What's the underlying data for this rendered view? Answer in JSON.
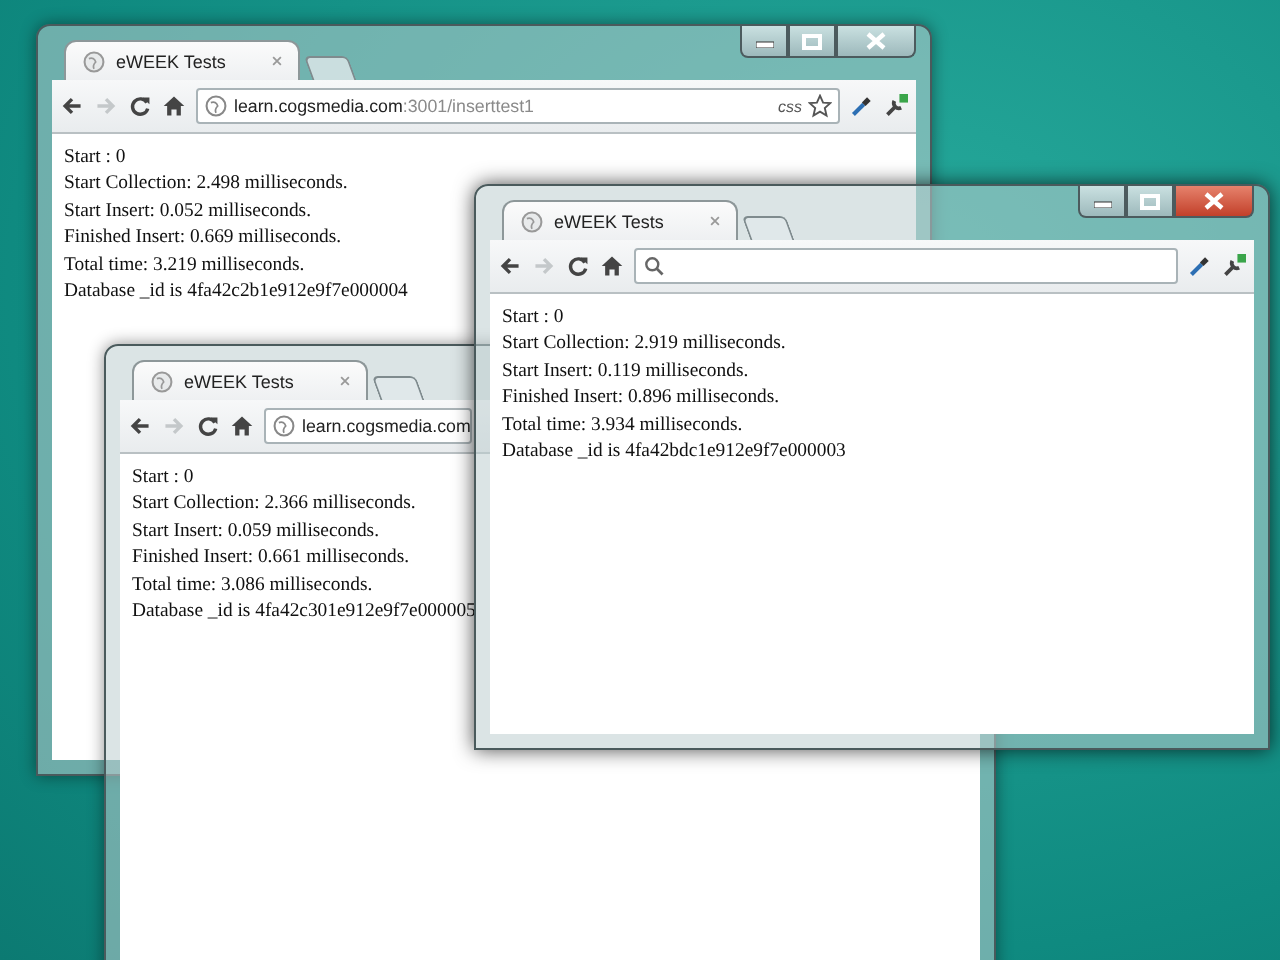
{
  "windows": [
    {
      "tab_title": "eWEEK Tests",
      "caption_buttons": true,
      "focused": false,
      "omnibox": {
        "kind": "url",
        "host": "learn.cogsmedia.com",
        "path": ":3001/inserttest1"
      },
      "badge": "css",
      "star": true,
      "tools": true,
      "lines": [
        "Start : 0",
        "Start Collection: 2.498 milliseconds.",
        "Start Insert: 0.052 milliseconds.",
        "Finished Insert: 0.669 milliseconds.",
        "Total time: 3.219 milliseconds.",
        "Database _id is 4fa42c2b1e912e9f7e000004"
      ]
    },
    {
      "tab_title": "eWEEK Tests",
      "omnibox": {
        "kind": "url",
        "host": "learn.cogsmedia.com"
      },
      "lines": [
        "Start : 0",
        "Start Collection: 2.366 milliseconds.",
        "Start Insert: 0.059 milliseconds.",
        "Finished Insert: 0.661 milliseconds.",
        "Total time: 3.086 milliseconds.",
        "Database _id is 4fa42c301e912e9f7e000005"
      ]
    },
    {
      "tab_title": "eWEEK Tests",
      "caption_buttons": true,
      "focused": true,
      "omnibox": {
        "kind": "search"
      },
      "star": false,
      "tools": true,
      "lines": [
        "Start : 0",
        "Start Collection: 2.919 milliseconds.",
        "Start Insert: 0.119 milliseconds.",
        "Finished Insert: 0.896 milliseconds.",
        "Total time: 3.934 milliseconds.",
        "Database _id is 4fa42bdc1e912e9f7e000003"
      ]
    }
  ]
}
